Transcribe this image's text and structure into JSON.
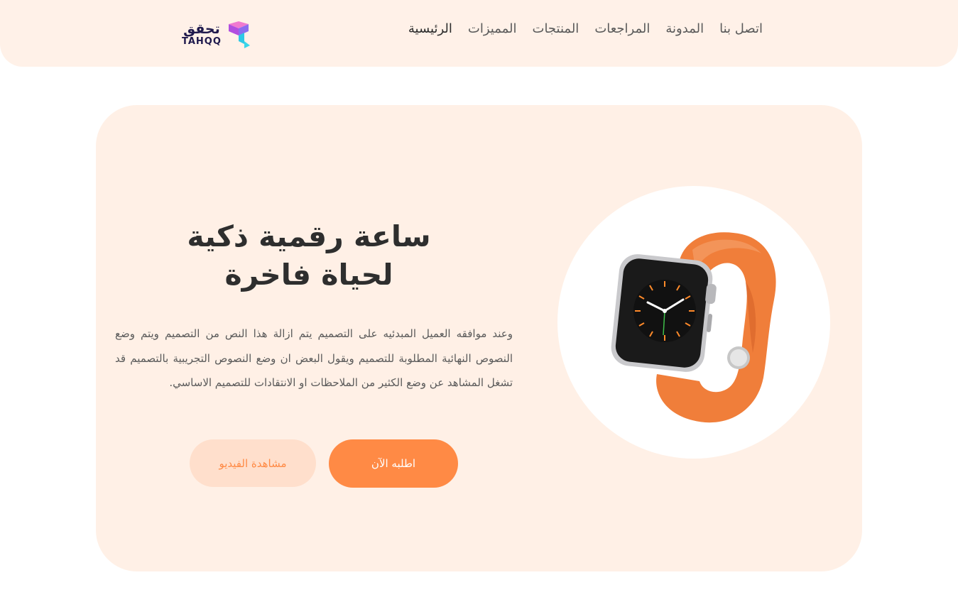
{
  "nav": {
    "links": [
      {
        "label": "الرئيسية",
        "active": true
      },
      {
        "label": "المميزات",
        "active": false
      },
      {
        "label": "المنتجات",
        "active": false
      },
      {
        "label": "المراجعات",
        "active": false
      },
      {
        "label": "المدونة",
        "active": false
      },
      {
        "label": "اتصل بنا",
        "active": false
      }
    ],
    "logo": {
      "arabic": "تحقق",
      "latin": "TAHQQ"
    }
  },
  "hero": {
    "title_line1": "ساعة رقمية ذكية",
    "title_line2": "لحياة فاخرة",
    "description": "وعند موافقه العميل المبدئيه على التصميم يتم ازالة هذا النص من التصميم ويتم وضع النصوص النهائية المطلوبة للتصميم ويقول البعض ان وضع النصوص التجريبية بالتصميم قد تشغل المشاهد عن وضع الكثير من الملاحظات او الانتقادات للتصميم الاساسي.",
    "primary_button": "اطلبه الآن",
    "secondary_button": "مشاهدة الفيديو",
    "image": "smartwatch-orange-band"
  },
  "colors": {
    "accent": "#ff8a45",
    "accent_light": "#ffdfcc",
    "background_peach": "#fff1e8",
    "text_dark": "#2e2e2e",
    "text_muted": "#5a5a5a"
  }
}
